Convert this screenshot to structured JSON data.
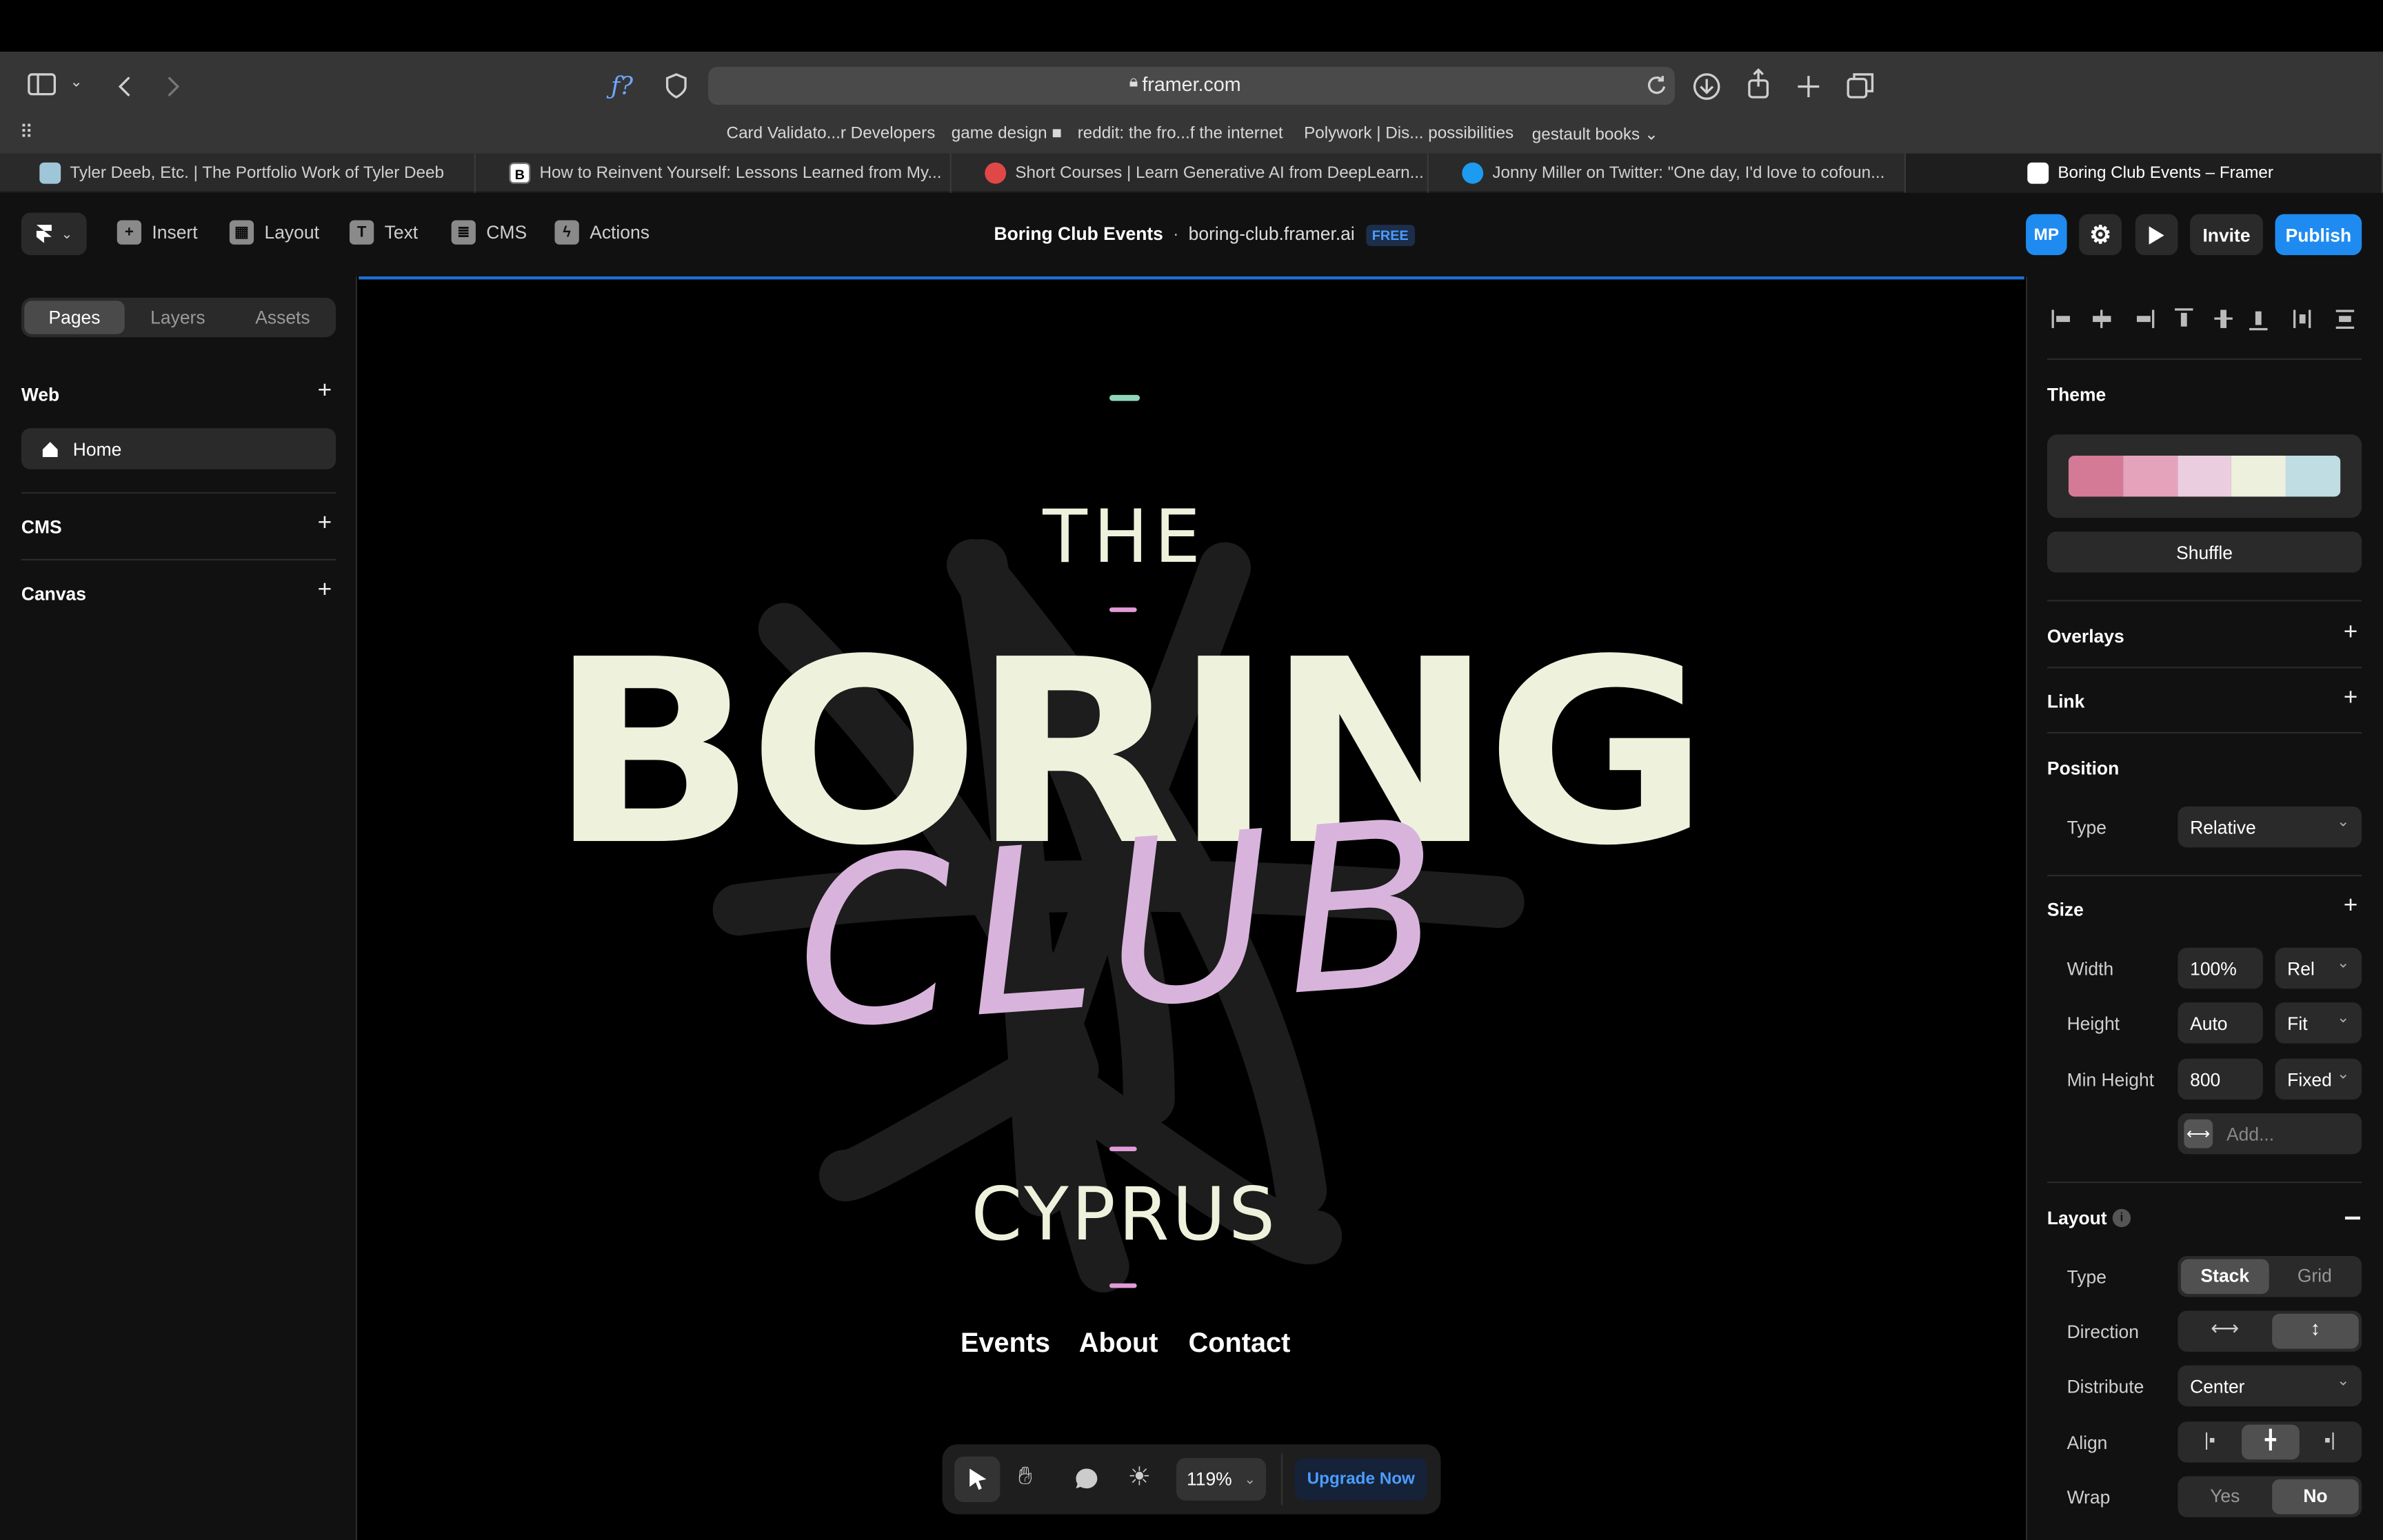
{
  "browser": {
    "url": "framer.com",
    "bookmarks": [
      "Card Validato...r Developers",
      "game design ■",
      "reddit: the fro...f the internet",
      "Polywork | Dis... possibilities",
      "gestault books ⌄"
    ],
    "tabs": [
      {
        "label": "Tyler Deeb, Etc. | The Portfolio Work of Tyler Deeb"
      },
      {
        "label": "How to Reinvent Yourself: Lessons Learned from My..."
      },
      {
        "label": "Short Courses | Learn Generative AI from DeepLearn..."
      },
      {
        "label": "Jonny Miller on Twitter: \"One day, I'd love to cofoun..."
      },
      {
        "label": "Boring Club Events – Framer"
      }
    ]
  },
  "toolbar": {
    "insert": "Insert",
    "layout": "Layout",
    "text": "Text",
    "cms": "CMS",
    "actions": "Actions",
    "project_title": "Boring Club Events",
    "separator": "·",
    "domain": "boring-club.framer.ai",
    "plan_badge": "FREE",
    "avatar": "MP",
    "invite": "Invite",
    "publish": "Publish"
  },
  "left_panel": {
    "tabs": [
      "Pages",
      "Layers",
      "Assets"
    ],
    "active_tab": "Pages",
    "web": "Web",
    "home": "Home",
    "cms": "CMS",
    "canvas": "Canvas"
  },
  "canvas": {
    "the": "THE",
    "boring": "BORING",
    "club": "CLUB",
    "cyprus": "CYPRUS",
    "nav": [
      "Events",
      "About",
      "Contact"
    ],
    "zoom": "119%",
    "upgrade": "Upgrade Now"
  },
  "right_panel": {
    "theme": "Theme",
    "swatches": [
      "#d47a96",
      "#e5a3bb",
      "#ebcde0",
      "#ecf0dc",
      "#bfdde3"
    ],
    "shuffle": "Shuffle",
    "overlays": "Overlays",
    "link": "Link",
    "position": "Position",
    "type_label": "Type",
    "position_type": "Relative",
    "size": "Size",
    "width_label": "Width",
    "width_value": "100%",
    "width_unit": "Rel",
    "height_label": "Height",
    "height_value": "Auto",
    "height_unit": "Fit",
    "min_height_label": "Min Height",
    "min_height_value": "800",
    "min_height_unit": "Fixed",
    "add_placeholder": "Add...",
    "layout": "Layout",
    "layout_type_label": "Type",
    "layout_type_options": [
      "Stack",
      "Grid"
    ],
    "layout_type_selected": "Stack",
    "direction_label": "Direction",
    "direction_selected": "vertical",
    "distribute_label": "Distribute",
    "distribute_value": "Center",
    "align_label": "Align",
    "align_selected": "center",
    "wrap_label": "Wrap",
    "wrap_options": [
      "Yes",
      "No"
    ],
    "wrap_selected": "No"
  },
  "colors": {
    "accent": "#1f8bf0",
    "headline_cream": "#eef2dc",
    "club_lilac": "#d8b4dc",
    "dash_mint": "#8fd6b8",
    "dash_pink": "#e39ad8"
  }
}
